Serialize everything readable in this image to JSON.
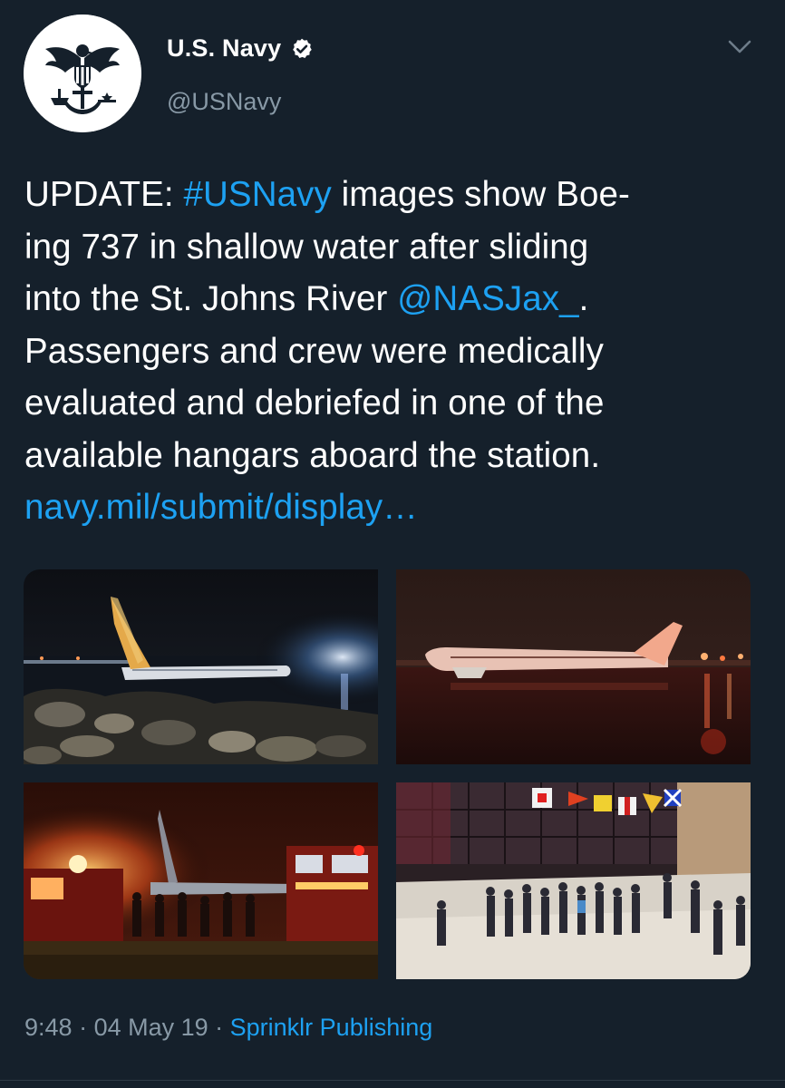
{
  "author": {
    "display_name": "U.S. Navy",
    "handle": "@USNavy",
    "verified_icon": "verified-badge-icon",
    "avatar_icon": "navy-eagle-anchor-logo"
  },
  "menu": {
    "icon": "chevron-down-icon"
  },
  "tweet": {
    "lines": [
      [
        {
          "text": "UPDATE: ",
          "link": false
        },
        {
          "text": "#USNavy",
          "link": true
        },
        {
          "text": " images show Boe-",
          "link": false
        }
      ],
      [
        {
          "text": "ing 737 in shallow water after sliding",
          "link": false
        }
      ],
      [
        {
          "text": "into the St. Johns River ",
          "link": false
        },
        {
          "text": "@NASJax_",
          "link": true
        },
        {
          "text": ".",
          "link": false
        }
      ],
      [
        {
          "text": "Passengers and crew were medically",
          "link": false
        }
      ],
      [
        {
          "text": "evaluated and debriefed in one of the",
          "link": false
        }
      ],
      [
        {
          "text": "available hangars aboard the station.",
          "link": false
        }
      ],
      [
        {
          "text": "navy.mil/submit/display…",
          "link": true
        }
      ]
    ]
  },
  "media": {
    "count": 4
  },
  "meta": {
    "time": "9:48",
    "separator": " · ",
    "date": "04 May 19",
    "source": "Sprinklr Publishing"
  },
  "colors": {
    "background": "#15202b",
    "link": "#1da1f2",
    "secondary_text": "#8899a6",
    "primary_text": "#ffffff"
  }
}
